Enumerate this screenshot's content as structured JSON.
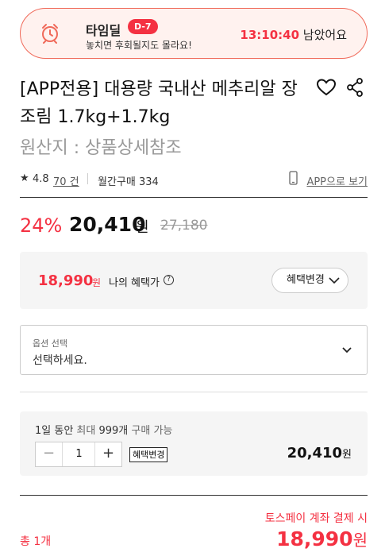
{
  "timedeal": {
    "title": "타임딜",
    "badge": "D-7",
    "subtitle": "놓치면 후회될지도 몰라요!",
    "time": "13:10:40",
    "time_suffix": " 남았어요",
    "icon": "alarm-clock-icon"
  },
  "product": {
    "title": "[APP전용] 대용량 국내산 메추리알 장조림 1.7kg+1.7kg",
    "origin": "원산지 : 상품상세참조",
    "icons": [
      "heart-icon",
      "share-icon"
    ]
  },
  "rating": {
    "star": "★",
    "score": "4.8",
    "reviews": "70 건",
    "monthly": "월간구매 334",
    "app_link": "APP으로 보기"
  },
  "price": {
    "discount": "24%",
    "sale": "20,410",
    "won": "원",
    "original": "27,180"
  },
  "benefit": {
    "price": "18,990",
    "won": "원",
    "label": "나의 혜택가",
    "info": "?",
    "button": "혜택변경"
  },
  "option": {
    "label": "옵션 선택",
    "placeholder": "선택하세요."
  },
  "quantity": {
    "limit_prefix": "1일 동안",
    "limit_mid": " 최대 ",
    "limit_value": "999개",
    "limit_suffix": " 구매 가능",
    "minus": "−",
    "value": "1",
    "plus": "+",
    "benefit_tag": "혜택변경",
    "price": "20,410",
    "won": "원"
  },
  "footer": {
    "toss": "토스페이 계좌 결제 시",
    "total": "총 1개",
    "final_price": "18,990",
    "won": "원"
  },
  "colors": {
    "accent": "#f43142",
    "timedeal_bg": "#fff2ef",
    "timedeal_border": "#f06a5a"
  }
}
